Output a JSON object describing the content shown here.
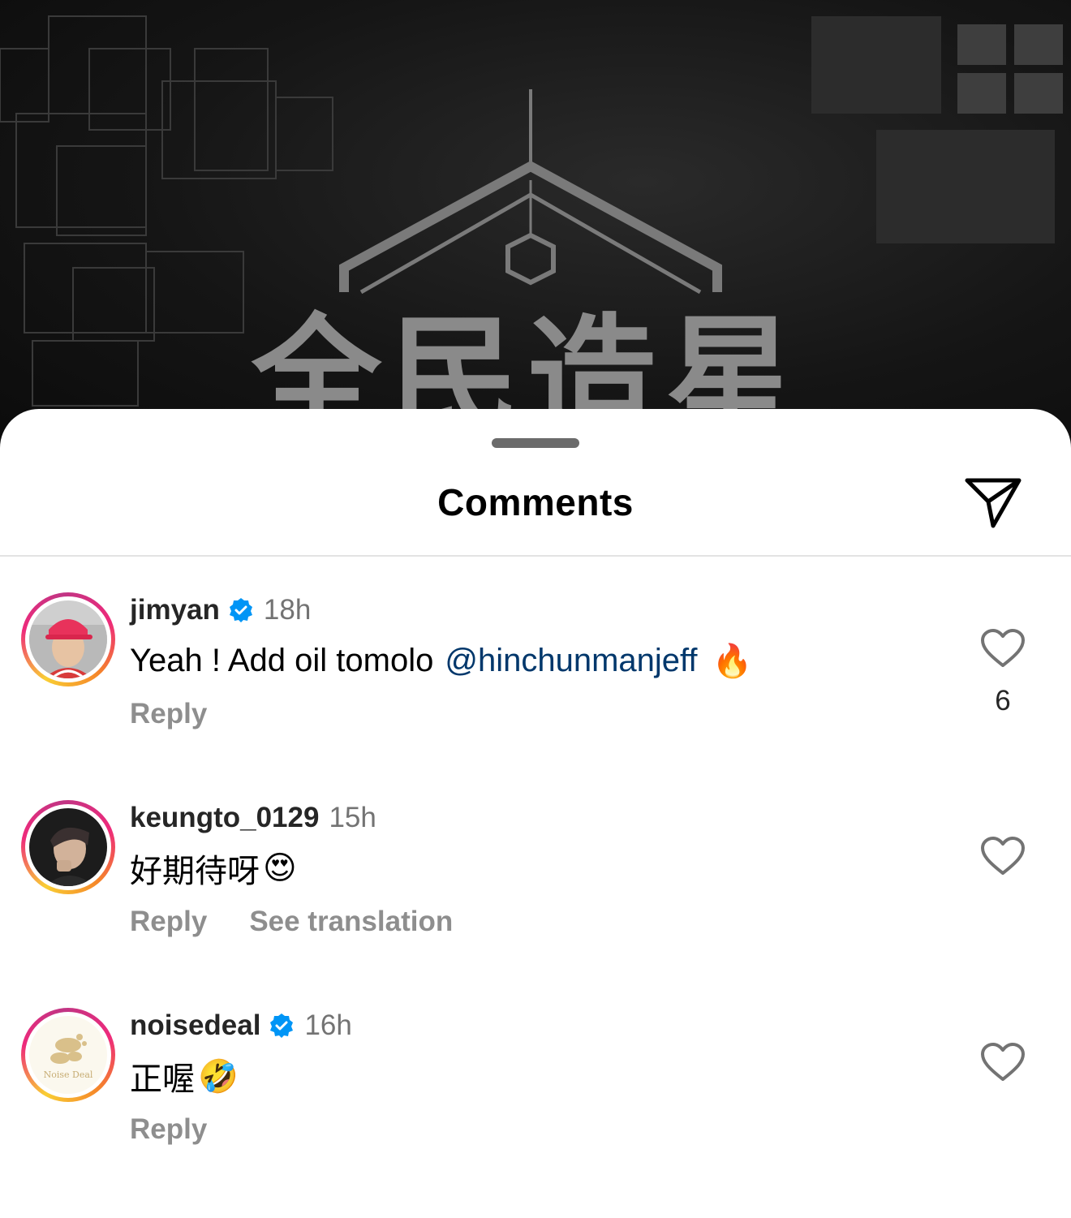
{
  "background": {
    "logo_icon": "house-hexagon-logo-icon",
    "logo_text": "全民造星"
  },
  "sheet": {
    "title": "Comments",
    "share_icon": "paper-plane-icon"
  },
  "comments": [
    {
      "username": "jimyan",
      "verified": true,
      "time": "18h",
      "text": "Yeah ! Add oil tomolo",
      "mention": "@hinchunmanjeff",
      "emoji": "🔥",
      "actions": [
        "Reply"
      ],
      "like_count": "6"
    },
    {
      "username": "keungto_0129",
      "verified": false,
      "time": "15h",
      "text": "好期待呀",
      "emoji": "😍",
      "actions": [
        "Reply",
        "See translation"
      ]
    },
    {
      "username": "noisedeal",
      "verified": true,
      "time": "16h",
      "text": "正喔",
      "emoji": "🤣",
      "actions": [
        "Reply"
      ],
      "avatar_text": "Noise Deal"
    }
  ],
  "colors": {
    "mention": "#00376b",
    "verified": "#0095f6",
    "secondary_text": "#737373",
    "action_text": "#8e8e8e"
  }
}
